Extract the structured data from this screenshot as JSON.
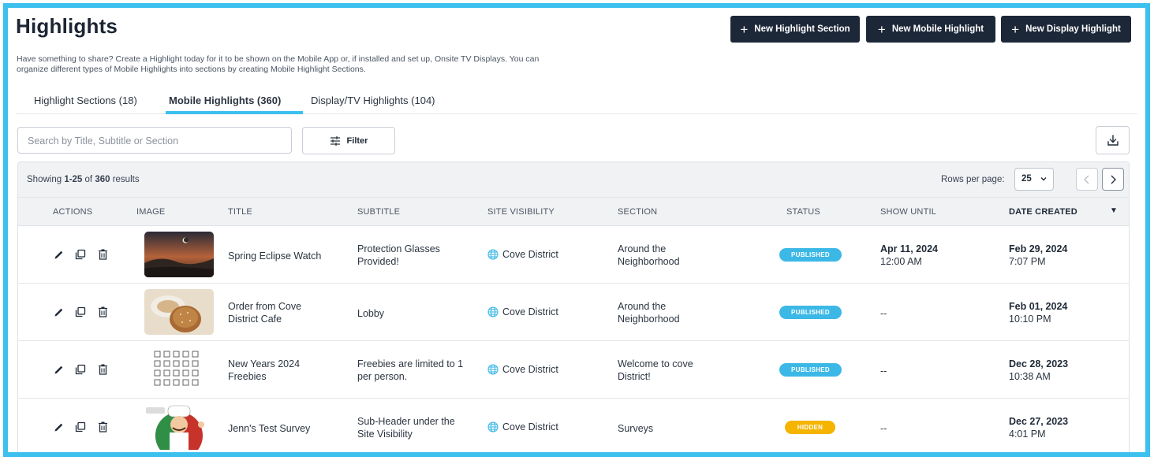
{
  "header": {
    "title": "Highlights",
    "description": "Have something to share? Create a Highlight today for it to be shown on the Mobile App or, if installed and set up, Onsite TV Displays. You can organize different types of Mobile Highlights into sections by creating Mobile Highlight Sections.",
    "buttons": [
      {
        "label": "New Highlight Section",
        "icon": "plus-icon"
      },
      {
        "label": "New Mobile Highlight",
        "icon": "plus-icon"
      },
      {
        "label": "New Display Highlight",
        "icon": "plus-icon"
      }
    ]
  },
  "tabs": [
    {
      "label": "Highlight Sections (18)",
      "active": false
    },
    {
      "label": "Mobile Highlights (360)",
      "active": true
    },
    {
      "label": "Display/TV Highlights (104)",
      "active": false
    }
  ],
  "toolbar": {
    "search_placeholder": "Search by Title, Subtitle or Section",
    "filter_label": "Filter",
    "download_icon": "download-icon"
  },
  "table": {
    "showing_prefix": "Showing ",
    "showing_range": "1-25",
    "showing_of": " of ",
    "showing_total": "360",
    "showing_suffix": " results",
    "rows_per_page_label": "Rows per page:",
    "rows_per_page": "25",
    "columns": [
      "ACTIONS",
      "IMAGE",
      "TITLE",
      "SUBTITLE",
      "SITE VISIBILITY",
      "SECTION",
      "STATUS",
      "SHOW UNTIL",
      "DATE CREATED"
    ],
    "sorted_column": "DATE CREATED",
    "sort_direction": "descending",
    "accent_color": "#3cc0ee",
    "rows": [
      {
        "image": "eclipse-photo",
        "title": "Spring Eclipse Watch",
        "subtitle": "Protection Glasses Provided!",
        "visibility": "Cove District",
        "section": "Around the Neighborhood",
        "status": "PUBLISHED",
        "show_until_date": "Apr 11, 2024",
        "show_until_time": "12:00 AM",
        "created_date": "Feb 29, 2024",
        "created_time": "7:07 PM"
      },
      {
        "image": "bagel-photo",
        "title": "Order from Cove District Cafe",
        "subtitle": "Lobby",
        "visibility": "Cove District",
        "section": "Around the Neighborhood",
        "status": "PUBLISHED",
        "show_until_date": "--",
        "show_until_time": "",
        "created_date": "Feb 01, 2024",
        "created_time": "10:10 PM"
      },
      {
        "image": "icon-grid-image",
        "title": "New Years 2024 Freebies",
        "subtitle": "Freebies are limited to 1 per person.",
        "visibility": "Cove District",
        "section": "Welcome to cove District!",
        "status": "PUBLISHED",
        "show_until_date": "--",
        "show_until_time": "",
        "created_date": "Dec 28, 2023",
        "created_time": "10:38 AM"
      },
      {
        "image": "chef-illustration",
        "title": "Jenn's Test Survey",
        "subtitle": "Sub-Header under the Site Visibility",
        "visibility": "Cove District",
        "section": "Surveys",
        "status": "HIDDEN",
        "show_until_date": "--",
        "show_until_time": "",
        "created_date": "Dec 27, 2023",
        "created_time": "4:01 PM"
      }
    ]
  }
}
